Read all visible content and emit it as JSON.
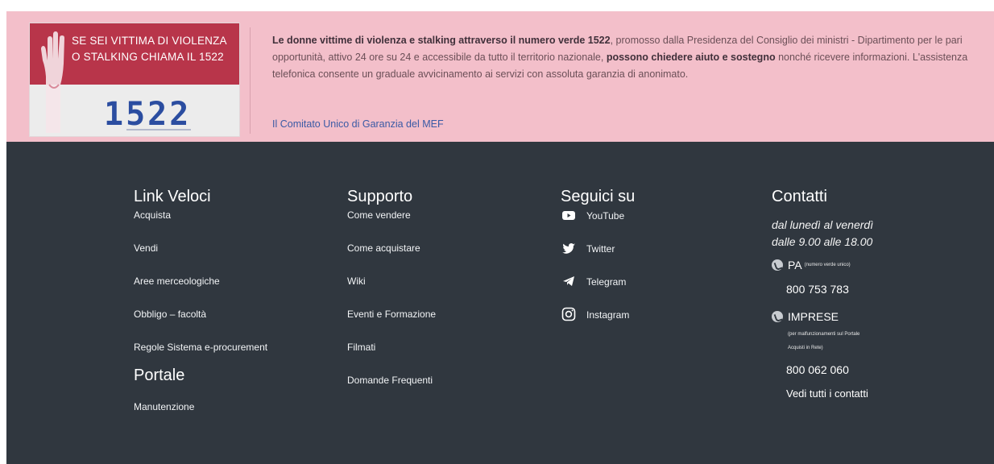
{
  "banner": {
    "image_line1": "SE SEI VITTIMA DI VIOLENZA",
    "image_line2": "O STALKING CHIAMA IL 1522",
    "image_number": "1522",
    "bold1": "Le donne vittime di violenza e stalking attraverso il numero verde 1522",
    "text1": ", promosso dalla Presidenza del Consiglio dei ministri - Dipartimento per le pari opportunità, attivo 24 ore su 24 e accessibile da tutto il territorio nazionale, ",
    "bold2": "possono chiedere aiuto e sostegno",
    "text2": " nonché ricevere informazioni. L'assistenza telefonica consente un graduale avvicinamento ai servizi con assoluta garanzia di anonimato.",
    "link": "Il Comitato Unico di Garanzia del MEF"
  },
  "footer": {
    "link_veloci": {
      "title": "Link Veloci",
      "items": [
        "Acquista",
        "Vendi",
        "Aree merceologiche",
        "Obbligo – facoltà",
        "Regole Sistema e-procurement"
      ]
    },
    "portale": {
      "title": "Portale",
      "items": [
        "Manutenzione"
      ]
    },
    "supporto": {
      "title": "Supporto",
      "items": [
        "Come vendere",
        "Come acquistare",
        "Wiki",
        "Eventi e Formazione",
        "Filmati",
        "Domande Frequenti"
      ]
    },
    "seguici": {
      "title": "Seguici su",
      "items": [
        {
          "label": "YouTube",
          "icon": "youtube-icon"
        },
        {
          "label": "Twitter",
          "icon": "twitter-icon"
        },
        {
          "label": "Telegram",
          "icon": "telegram-icon"
        },
        {
          "label": "Instagram",
          "icon": "instagram-icon"
        }
      ]
    },
    "contatti": {
      "title": "Contatti",
      "hours_line1": "dal lunedì al venerdì",
      "hours_line2": "dalle 9.00 alle 18.00",
      "pa_label": "PA",
      "pa_note": "(numero verde unico)",
      "pa_number": "800 753 783",
      "imprese_label": "IMPRESE",
      "imprese_note_line1": "(per malfunzionamenti sul Portale",
      "imprese_note_line2": "Acquisti in Rete)",
      "imprese_number": "800 062 060",
      "all_contacts": "Vedi tutti i contatti"
    }
  },
  "colors": {
    "banner_bg": "#f3bfca",
    "footer_bg": "#30373f",
    "promo_red": "#b8354a",
    "promo_blue": "#2b4da0",
    "link_blue": "#3a5aa5"
  }
}
